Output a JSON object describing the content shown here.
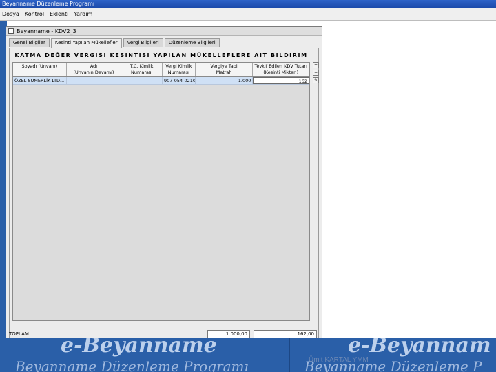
{
  "app": {
    "title": "Beyanname Düzenleme Programı",
    "menu": [
      "Dosya",
      "Kontrol",
      "Eklenti",
      "Yardım"
    ]
  },
  "window": {
    "title": "Beyanname - KDV2_3"
  },
  "tabs": [
    {
      "label": "Genel Bilgiler",
      "active": false
    },
    {
      "label": "Kesinti Yapılan Mükellefler",
      "active": true
    },
    {
      "label": "Vergi Bilgileri",
      "active": false
    },
    {
      "label": "Düzenleme Bilgileri",
      "active": false
    }
  ],
  "panel": {
    "heading": "KATMA DEĞER VERGISI KESINTISI YAPILAN MÜKELLEFLERE AIT BILDIRIM"
  },
  "table": {
    "columns": [
      [
        "Soyadı (Unvanı)",
        ""
      ],
      [
        "Adı",
        "(Unvanın Devamı)"
      ],
      [
        "T.C. Kimlik",
        "Numarası"
      ],
      [
        "Vergi Kimlik",
        "Numarası"
      ],
      [
        "Vergiye Tabi",
        "Matrah"
      ],
      [
        "Tevkif Edilen KDV Tutarı",
        "(Kesinti Miktarı)"
      ]
    ],
    "rows": [
      [
        "ÖZEL SUMERLİK LTD...",
        "",
        "",
        "907-054-0210",
        "1.000",
        "162"
      ]
    ]
  },
  "footer": {
    "label": "TOPLAM",
    "total_matrah": "1.000,00",
    "total_kdv": "162,00"
  },
  "banner": {
    "left_title": "e-Beyanname",
    "right_title": "e-Beyannam",
    "left_subtitle": "Beyanname Düzenleme Programı",
    "right_subtitle": "Beyanname Düzenleme P",
    "author": "Ümit KARTAL YMM"
  },
  "colors": {
    "titlebar": "#2e63c8",
    "banner": "#2a5fa8",
    "selected_row": "#cfe0f5"
  }
}
